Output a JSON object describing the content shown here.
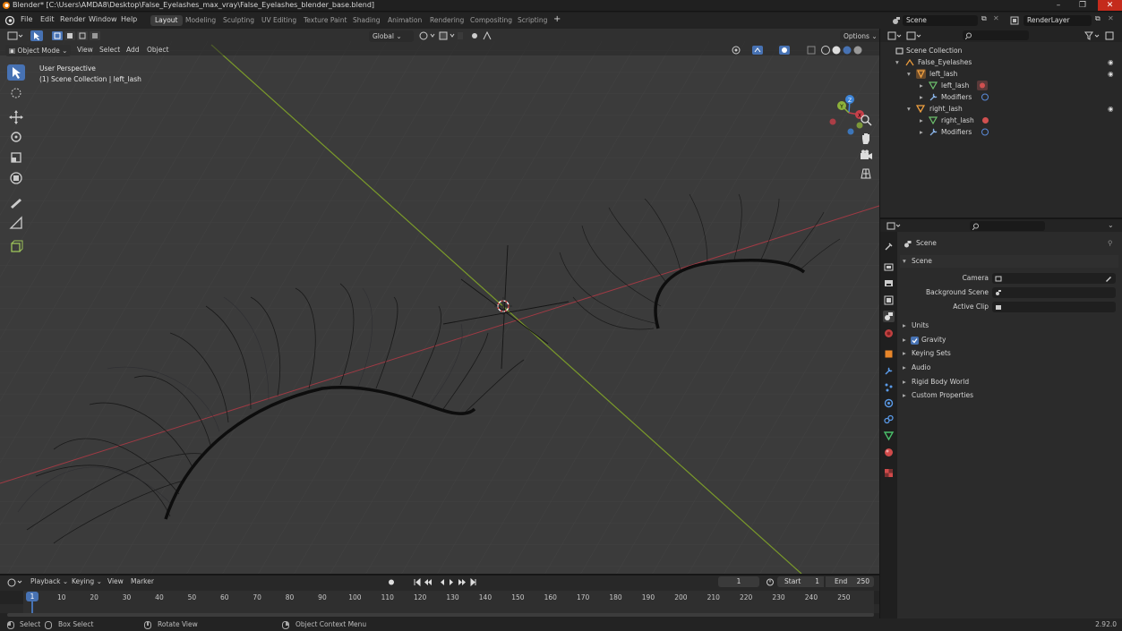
{
  "window": {
    "title": "Blender* [C:\\Users\\AMDA8\\Desktop\\False_Eyelashes_max_vray\\False_Eyelashes_blender_base.blend]"
  },
  "menu": [
    "File",
    "Edit",
    "Render",
    "Window",
    "Help"
  ],
  "workspace_tabs": [
    "Layout",
    "Modeling",
    "Sculpting",
    "UV Editing",
    "Texture Paint",
    "Shading",
    "Animation",
    "Rendering",
    "Compositing",
    "Scripting"
  ],
  "active_workspace": "Layout",
  "scene_field": "Scene",
  "view_layer_field": "RenderLayer",
  "viewport": {
    "mode": "Object Mode",
    "menus": [
      "View",
      "Select",
      "Add",
      "Object"
    ],
    "orientation": "Global",
    "options": "Options",
    "overlay_title": "User Perspective",
    "overlay_subtitle": "(1) Scene Collection | left_lash",
    "gizmo_axes": [
      "Z",
      "Y",
      "X"
    ]
  },
  "outliner": {
    "rows": [
      {
        "label": "Scene Collection"
      },
      {
        "label": "False_Eyelashes"
      },
      {
        "label": "left_lash"
      },
      {
        "label": "left_lash"
      },
      {
        "label": "Modifiers"
      },
      {
        "label": "right_lash"
      },
      {
        "label": "right_lash"
      },
      {
        "label": "Modifiers"
      }
    ]
  },
  "properties": {
    "context": "Scene",
    "panel": "Scene",
    "fields": [
      {
        "label": "Camera"
      },
      {
        "label": "Background Scene"
      },
      {
        "label": "Active Clip"
      }
    ],
    "sections": [
      "Units",
      "Gravity",
      "Keying Sets",
      "Audio",
      "Rigid Body World",
      "Custom Properties"
    ]
  },
  "timeline": {
    "menus": [
      "Playback",
      "Keying",
      "View",
      "Marker"
    ],
    "current_frame": "1",
    "start_label": "Start",
    "start": "1",
    "end_label": "End",
    "end": "250",
    "ruler": [
      "1",
      "10",
      "20",
      "30",
      "40",
      "50",
      "60",
      "70",
      "80",
      "90",
      "100",
      "110",
      "120",
      "130",
      "140",
      "150",
      "160",
      "170",
      "180",
      "190",
      "200",
      "210",
      "220",
      "230",
      "240",
      "250"
    ]
  },
  "statusbar": {
    "items": [
      "Select",
      "Box Select",
      "Rotate View",
      "Object Context Menu"
    ],
    "version": "2.92.0"
  },
  "colors": {
    "accent": "#4772b3",
    "x_axis": "#c8404a",
    "y_axis": "#8db23a",
    "z_axis": "#3d85d9"
  }
}
